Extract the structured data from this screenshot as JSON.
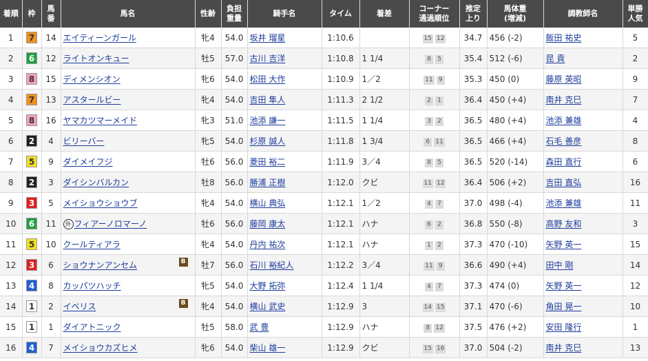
{
  "headers": {
    "rank": "着順",
    "waku": "枠",
    "umaban": [
      "馬",
      "番"
    ],
    "horse": "馬名",
    "sexage": "性齢",
    "weight": [
      "負担",
      "重量"
    ],
    "jockey": "騎手名",
    "time": "タイム",
    "margin": "着差",
    "corner": [
      "コーナー",
      "通過順位"
    ],
    "last3f": [
      "推定",
      "上り"
    ],
    "bodyweight": [
      "馬体重",
      "(増減)"
    ],
    "trainer": "調教師名",
    "odds": [
      "単勝",
      "人気"
    ]
  },
  "waku_colors": {
    "1": {
      "bg": "#ffffff",
      "fg": "#333333"
    },
    "2": {
      "bg": "#222222",
      "fg": "#ffffff"
    },
    "3": {
      "bg": "#e02020",
      "fg": "#ffffff"
    },
    "4": {
      "bg": "#2060d0",
      "fg": "#ffffff"
    },
    "5": {
      "bg": "#f5e020",
      "fg": "#333333"
    },
    "6": {
      "bg": "#20a040",
      "fg": "#ffffff"
    },
    "7": {
      "bg": "#f09020",
      "fg": "#333333"
    },
    "8": {
      "bg": "#f5a0c0",
      "fg": "#333333"
    }
  },
  "blinker_label": "B",
  "foreign_label": "外",
  "rows": [
    {
      "rank": "1",
      "waku": "7",
      "umaban": "14",
      "horse": "エイティーンガール",
      "blinker": false,
      "foreign": false,
      "sexage": "牝4",
      "weight": "54.0",
      "jockey": "坂井 瑠星",
      "time": "1:10.6",
      "margin": "",
      "corner": [
        "15",
        "12"
      ],
      "last3f": "34.7",
      "bodyweight": "456 (-2)",
      "trainer": "飯田 祐史",
      "odds": "5"
    },
    {
      "rank": "2",
      "waku": "6",
      "umaban": "12",
      "horse": "ライトオンキュー",
      "blinker": false,
      "foreign": false,
      "sexage": "牡5",
      "weight": "57.0",
      "jockey": "古川 吉洋",
      "time": "1:10.8",
      "margin": "1 1/4",
      "corner": [
        "8",
        "5"
      ],
      "last3f": "35.4",
      "bodyweight": "512 (-6)",
      "trainer": "昆 貢",
      "odds": "2"
    },
    {
      "rank": "3",
      "waku": "8",
      "umaban": "15",
      "horse": "ディメンシオン",
      "blinker": false,
      "foreign": false,
      "sexage": "牝6",
      "weight": "54.0",
      "jockey": "松田 大作",
      "time": "1:10.9",
      "margin": "1／2",
      "corner": [
        "11",
        "9"
      ],
      "last3f": "35.3",
      "bodyweight": "450 (0)",
      "trainer": "藤原 英昭",
      "odds": "9"
    },
    {
      "rank": "4",
      "waku": "7",
      "umaban": "13",
      "horse": "アスタールビー",
      "blinker": false,
      "foreign": false,
      "sexage": "牝4",
      "weight": "54.0",
      "jockey": "吉田 隼人",
      "time": "1:11.3",
      "margin": "2 1/2",
      "corner": [
        "2",
        "1"
      ],
      "last3f": "36.4",
      "bodyweight": "450 (+4)",
      "trainer": "南井 克巳",
      "odds": "7"
    },
    {
      "rank": "5",
      "waku": "8",
      "umaban": "16",
      "horse": "ヤマカツマーメイド",
      "blinker": false,
      "foreign": false,
      "sexage": "牝3",
      "weight": "51.0",
      "jockey": "池添 謙一",
      "time": "1:11.5",
      "margin": "1 1/4",
      "corner": [
        "3",
        "2"
      ],
      "last3f": "36.5",
      "bodyweight": "480 (+4)",
      "trainer": "池添 兼雄",
      "odds": "4"
    },
    {
      "rank": "6",
      "waku": "2",
      "umaban": "4",
      "horse": "ビリーバー",
      "blinker": false,
      "foreign": false,
      "sexage": "牝5",
      "weight": "54.0",
      "jockey": "杉原 誠人",
      "time": "1:11.8",
      "margin": "1 3/4",
      "corner": [
        "6",
        "11"
      ],
      "last3f": "36.5",
      "bodyweight": "466 (+4)",
      "trainer": "石毛 善彦",
      "odds": "8"
    },
    {
      "rank": "7",
      "waku": "5",
      "umaban": "9",
      "horse": "ダイメイフジ",
      "blinker": false,
      "foreign": false,
      "sexage": "牡6",
      "weight": "56.0",
      "jockey": "菱田 裕二",
      "time": "1:11.9",
      "margin": "3／4",
      "corner": [
        "8",
        "5"
      ],
      "last3f": "36.5",
      "bodyweight": "520 (-14)",
      "trainer": "森田 直行",
      "odds": "6"
    },
    {
      "rank": "8",
      "waku": "2",
      "umaban": "3",
      "horse": "ダイシンバルカン",
      "blinker": false,
      "foreign": false,
      "sexage": "牡8",
      "weight": "56.0",
      "jockey": "勝浦 正樹",
      "time": "1:12.0",
      "margin": "クビ",
      "corner": [
        "11",
        "12"
      ],
      "last3f": "36.4",
      "bodyweight": "506 (+2)",
      "trainer": "吉田 直弘",
      "odds": "16"
    },
    {
      "rank": "9",
      "waku": "3",
      "umaban": "5",
      "horse": "メイショウショウブ",
      "blinker": false,
      "foreign": false,
      "sexage": "牝4",
      "weight": "54.0",
      "jockey": "横山 典弘",
      "time": "1:12.1",
      "margin": "1／2",
      "corner": [
        "4",
        "7"
      ],
      "last3f": "37.0",
      "bodyweight": "498 (-4)",
      "trainer": "池添 兼雄",
      "odds": "11"
    },
    {
      "rank": "10",
      "waku": "6",
      "umaban": "11",
      "horse": "フィアーノロマーノ",
      "blinker": false,
      "foreign": true,
      "sexage": "牡6",
      "weight": "56.0",
      "jockey": "藤岡 康太",
      "time": "1:12.1",
      "margin": "ハナ",
      "corner": [
        "6",
        "2"
      ],
      "last3f": "36.8",
      "bodyweight": "550 (-8)",
      "trainer": "高野 友和",
      "odds": "3"
    },
    {
      "rank": "11",
      "waku": "5",
      "umaban": "10",
      "horse": "クールティアラ",
      "blinker": false,
      "foreign": false,
      "sexage": "牝4",
      "weight": "54.0",
      "jockey": "丹内 祐次",
      "time": "1:12.1",
      "margin": "ハナ",
      "corner": [
        "1",
        "2"
      ],
      "last3f": "37.3",
      "bodyweight": "470 (-10)",
      "trainer": "矢野 英一",
      "odds": "15"
    },
    {
      "rank": "12",
      "waku": "3",
      "umaban": "6",
      "horse": "ショウナンアンセム",
      "blinker": true,
      "foreign": false,
      "sexage": "牡7",
      "weight": "56.0",
      "jockey": "石川 裕紀人",
      "time": "1:12.2",
      "margin": "3／4",
      "corner": [
        "11",
        "9"
      ],
      "last3f": "36.6",
      "bodyweight": "490 (+4)",
      "trainer": "田中 剛",
      "odds": "14"
    },
    {
      "rank": "13",
      "waku": "4",
      "umaban": "8",
      "horse": "カッパツハッチ",
      "blinker": false,
      "foreign": false,
      "sexage": "牝5",
      "weight": "54.0",
      "jockey": "大野 拓弥",
      "time": "1:12.4",
      "margin": "1 1/4",
      "corner": [
        "4",
        "7"
      ],
      "last3f": "37.3",
      "bodyweight": "474 (0)",
      "trainer": "矢野 英一",
      "odds": "12"
    },
    {
      "rank": "14",
      "waku": "1",
      "umaban": "2",
      "horse": "イベリス",
      "blinker": true,
      "foreign": false,
      "sexage": "牝4",
      "weight": "54.0",
      "jockey": "横山 武史",
      "time": "1:12.9",
      "margin": "3",
      "corner": [
        "14",
        "15"
      ],
      "last3f": "37.1",
      "bodyweight": "470 (-6)",
      "trainer": "角田 晃一",
      "odds": "10"
    },
    {
      "rank": "15",
      "waku": "1",
      "umaban": "1",
      "horse": "ダイアトニック",
      "blinker": false,
      "foreign": false,
      "sexage": "牡5",
      "weight": "58.0",
      "jockey": "武 豊",
      "time": "1:12.9",
      "margin": "ハナ",
      "corner": [
        "8",
        "12"
      ],
      "last3f": "37.5",
      "bodyweight": "476 (+2)",
      "trainer": "安田 隆行",
      "odds": "1"
    },
    {
      "rank": "16",
      "waku": "4",
      "umaban": "7",
      "horse": "メイショウカズヒメ",
      "blinker": false,
      "foreign": false,
      "sexage": "牝6",
      "weight": "54.0",
      "jockey": "柴山 雄一",
      "time": "1:12.9",
      "margin": "クビ",
      "corner": [
        "15",
        "16"
      ],
      "last3f": "37.0",
      "bodyweight": "504 (-2)",
      "trainer": "南井 克巳",
      "odds": "13"
    }
  ]
}
